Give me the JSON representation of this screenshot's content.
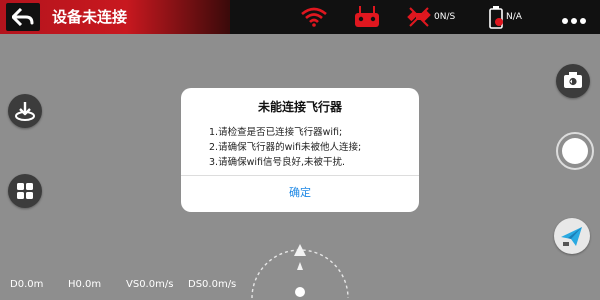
{
  "header": {
    "title": "设备未连接",
    "signal_status": "0N/S",
    "battery_status": "N/A"
  },
  "dialog": {
    "title": "未能连接飞行器",
    "lines": [
      "1.请检查是否已连接飞行器wifi;",
      "2.请确保飞行器的wifi未被他人连接;",
      "3.请确保wifi信号良好,未被干扰."
    ],
    "confirm_label": "确定"
  },
  "telemetry": {
    "distance": "D0.0m",
    "height": "H0.0m",
    "vertical_speed": "VS0.0m/s",
    "horizontal_speed": "DS0.0m/s"
  },
  "icons": {
    "back": "back-arrow-icon",
    "wifi": "wifi-icon",
    "controller": "remote-controller-icon",
    "satellite": "satellite-icon",
    "battery": "battery-icon",
    "more": "more-dots-icon",
    "takeoff": "takeoff-icon",
    "grid": "grid-menu-icon",
    "camera_switch": "camera-switch-icon",
    "shutter": "shutter-icon",
    "plane": "paper-plane-icon",
    "compass": "compass-icon"
  },
  "colors": {
    "status_red": "#e0171f",
    "link_blue": "#1e88e5",
    "background_gray": "#8e8e8e"
  }
}
